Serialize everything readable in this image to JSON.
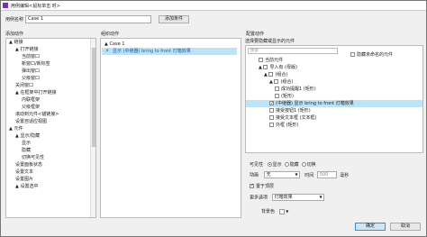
{
  "title": "用例编辑<鼠标单击 时>",
  "case_name_label": "用例名称",
  "case_name_value": "Case 1",
  "add_condition_button": "添加条件",
  "add_action_title": "添加动作",
  "organize_action_title": "组织动作",
  "configure_action_title": "配置动作",
  "add_action_tree": [
    {
      "label": "链接",
      "level": 0,
      "expander": "▲"
    },
    {
      "label": "打开链接",
      "level": 1,
      "expander": "▲"
    },
    {
      "label": "当前窗口",
      "level": 2
    },
    {
      "label": "新窗口/新标签",
      "level": 2
    },
    {
      "label": "弹出窗口",
      "level": 2
    },
    {
      "label": "父级窗口",
      "level": 2
    },
    {
      "label": "关闭窗口",
      "level": 1
    },
    {
      "label": "在框架中打开链接",
      "level": 1,
      "expander": "▲"
    },
    {
      "label": "内联框架",
      "level": 2
    },
    {
      "label": "父级框架",
      "level": 2
    },
    {
      "label": "滚动到元件<锚链接>",
      "level": 1
    },
    {
      "label": "设置自适应视图",
      "level": 1
    },
    {
      "label": "元件",
      "level": 0,
      "expander": "▲"
    },
    {
      "label": "显示/隐藏",
      "level": 1,
      "expander": "▲"
    },
    {
      "label": "显示",
      "level": 2
    },
    {
      "label": "隐藏",
      "level": 2
    },
    {
      "label": "切换可见性",
      "level": 2
    },
    {
      "label": "设置面板状态",
      "level": 1
    },
    {
      "label": "设置文本",
      "level": 1
    },
    {
      "label": "设置图片",
      "level": 1
    },
    {
      "label": "设置选中",
      "level": 1,
      "expander": "▲"
    }
  ],
  "case_label": "Case 1",
  "action_text": "显示 (中继器) bring to front 灯箱效果",
  "select_widget_title": "选择要隐藏或显示的元件",
  "search_placeholder": "搜索",
  "hide_unnamed_label": "隐藏未命名的元件",
  "widget_tree": [
    {
      "label": "当前元件",
      "level": 1,
      "checked": false
    },
    {
      "label": "导入有 (母版)",
      "level": 1,
      "checked": false,
      "expander": "▲"
    },
    {
      "label": "(组合)",
      "level": 2,
      "checked": false,
      "expander": "▲"
    },
    {
      "label": "(组合)",
      "level": 3,
      "checked": false,
      "expander": "▲"
    },
    {
      "label": "成功提醒1 (矩形)",
      "level": 4,
      "checked": false
    },
    {
      "label": "(矩形)",
      "level": 4,
      "checked": false
    },
    {
      "label": "(中继器) 显示 bring to front 灯箱效果",
      "level": 3,
      "checked": true,
      "selected": true
    },
    {
      "label": "接受按钮1 (矩形)",
      "level": 3,
      "checked": false
    },
    {
      "label": "接受文本框 (文本框)",
      "level": 3,
      "checked": false
    },
    {
      "label": "外框 (矩形)",
      "level": 3,
      "checked": false
    }
  ],
  "visibility_label": "可见性",
  "visibility_options": [
    "显示",
    "隐藏",
    "切换"
  ],
  "visibility_selected": 0,
  "animate_label": "动画",
  "animate_value": "无",
  "time_label": "时间",
  "time_value": "500",
  "ms_label": "毫秒",
  "bring_to_front_label": "置于顶层",
  "more_options_label": "更多选项",
  "more_options_value": "灯箱效果",
  "bg_color_label": "背景色",
  "ok_button": "确定",
  "cancel_button": "取消"
}
